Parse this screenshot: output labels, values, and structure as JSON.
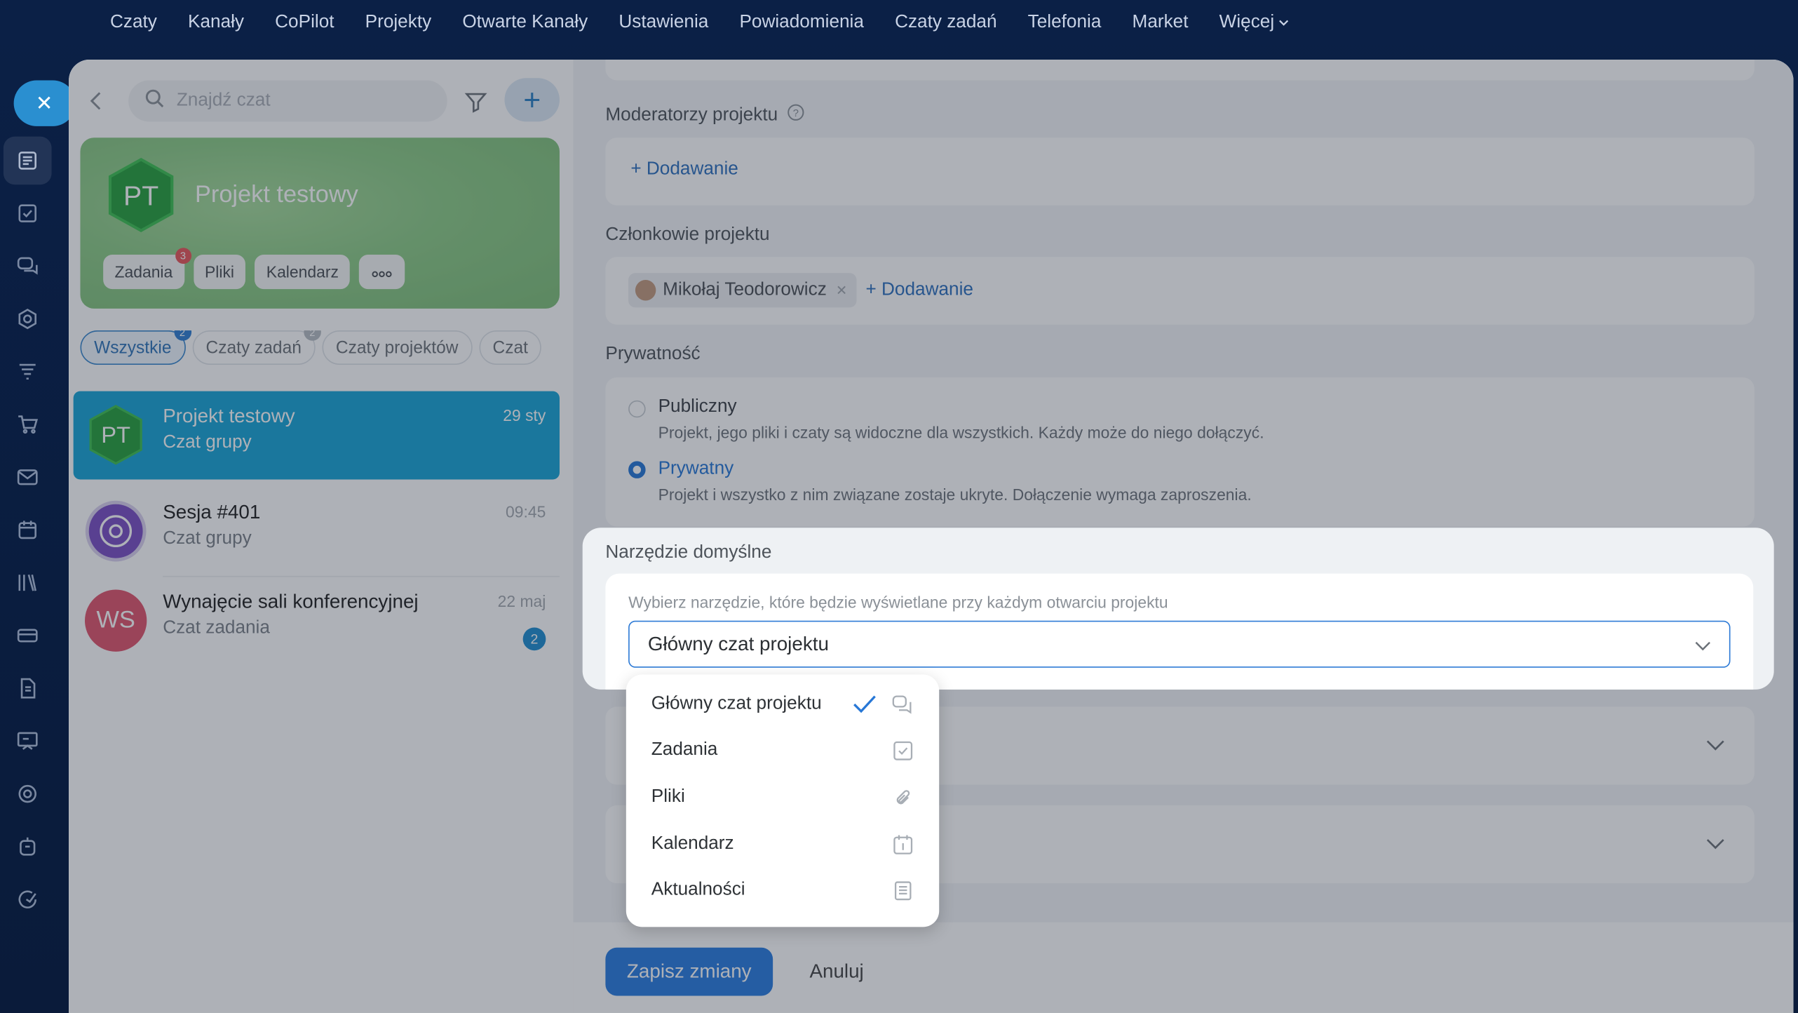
{
  "topnav": {
    "items": [
      "Czaty",
      "Kanały",
      "CoPilot",
      "Projekty",
      "Otwarte Kanały",
      "Ustawienia",
      "Powiadomienia",
      "Czaty zadań",
      "Telefonia",
      "Market"
    ],
    "more_label": "Więcej"
  },
  "search": {
    "placeholder": "Znajdź czat"
  },
  "project_card": {
    "initials": "PT",
    "title": "Projekt testowy",
    "chips": [
      {
        "label": "Zadania",
        "badge": "3"
      },
      {
        "label": "Pliki"
      },
      {
        "label": "Kalendarz"
      }
    ]
  },
  "tabs": [
    {
      "label": "Wszystkie",
      "badge": "2"
    },
    {
      "label": "Czaty zadań",
      "badge": "2"
    },
    {
      "label": "Czaty projektów"
    },
    {
      "label": "Czat"
    }
  ],
  "chats": [
    {
      "initials": "PT",
      "name": "Projekt testowy",
      "subtitle": "Czat grupy",
      "time": "29 sty"
    },
    {
      "name": "Sesja #401",
      "subtitle": "Czat grupy",
      "time": "09:45"
    },
    {
      "initials": "WS",
      "name": "Wynajęcie sali konferencyjnej",
      "subtitle": "Czat zadania",
      "time": "22 maj",
      "unread": "2"
    }
  ],
  "settings": {
    "moderators_label": "Moderatorzy projektu",
    "add_label": "+ Dodawanie",
    "members_label": "Członkowie projektu",
    "member_name": "Mikołaj Teodorowicz",
    "privacy_label": "Prywatność",
    "public_title": "Publiczny",
    "public_desc": "Projekt, jego pliki i czaty są widoczne dla wszystkich. Każdy może do niego dołączyć.",
    "private_title": "Prywatny",
    "private_desc": "Projekt i wszystko z nim związane zostaje ukryte. Dołączenie wymaga zaproszenia.",
    "default_tool_label": "Narzędzie domyślne",
    "default_tool_hint": "Wybierz narzędzie, które będzie wyświetlane przy każdym otwarciu projektu",
    "default_tool_value": "Główny czat projektu",
    "save_label": "Zapisz zmiany",
    "cancel_label": "Anuluj"
  },
  "dropdown": {
    "options": [
      {
        "label": "Główny czat projektu",
        "icon": "chat-icon",
        "selected": true
      },
      {
        "label": "Zadania",
        "icon": "task-checkbox-icon"
      },
      {
        "label": "Pliki",
        "icon": "paperclip-icon"
      },
      {
        "label": "Kalendarz",
        "icon": "calendar-icon"
      },
      {
        "label": "Aktualności",
        "icon": "news-icon"
      }
    ]
  },
  "colors": {
    "accent": "#2a7ce0",
    "selected_chat": "#18a4d6",
    "project_green": "#2f9e44"
  }
}
